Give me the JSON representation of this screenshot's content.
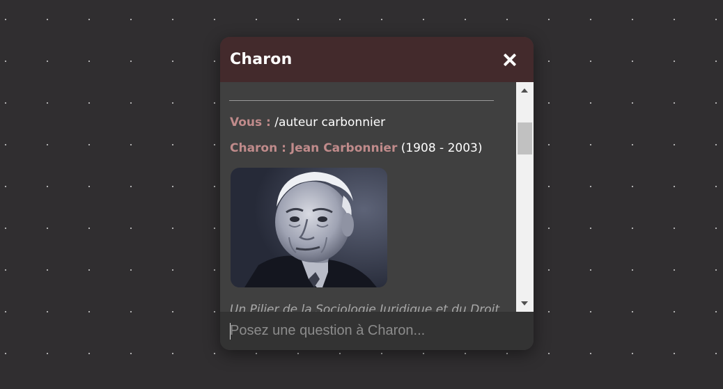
{
  "chat": {
    "title": "Charon",
    "close_icon": "close-icon",
    "messages": [
      {
        "speaker": "Vous :",
        "text": "/auteur carbonnier"
      },
      {
        "speaker": "Charon : Jean Carbonnier",
        "text": "(1908 - 2003)"
      }
    ],
    "photo_description_icon": "portrait-photo",
    "caption": "Un Pilier de la Sociologie Juridique et du Droit",
    "input": {
      "placeholder": "Posez une question à Charon...",
      "value": ""
    }
  },
  "colors": {
    "page_background": "#302e30",
    "header_background": "#432a2c",
    "panel_background": "#404040",
    "input_background": "#333333",
    "speaker_accent": "#c08b8b",
    "text": "#ffffff"
  }
}
